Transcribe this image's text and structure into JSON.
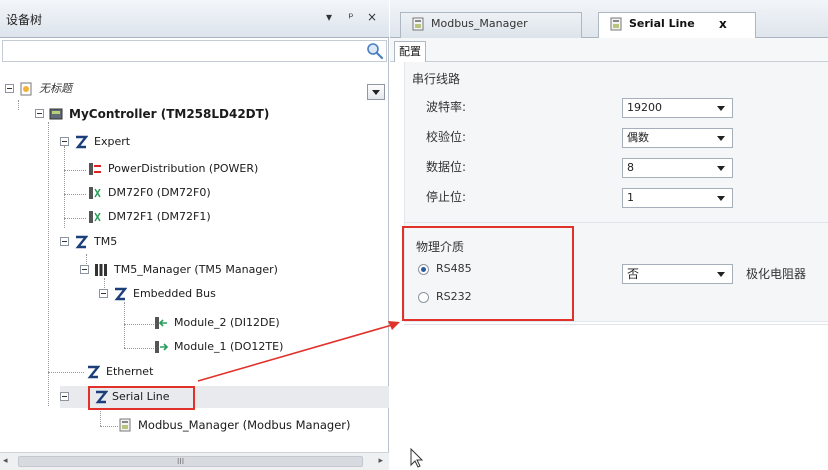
{
  "tree_panel": {
    "title": "设备树",
    "buttons": {
      "dropdown": "▾",
      "pin": "ᵖ",
      "close": "×"
    }
  },
  "tree": {
    "root": "无标题",
    "controller": "MyController (TM258LD42DT)",
    "expert": "Expert",
    "power_distribution": "PowerDistribution (POWER)",
    "dm72f0": "DM72F0 (DM72F0)",
    "dm72f1": "DM72F1 (DM72F1)",
    "tm5": "TM5",
    "tm5_manager": "TM5_Manager (TM5 Manager)",
    "embedded_bus": "Embedded Bus",
    "module_2": "Module_2 (DI12DE)",
    "module_1": "Module_1 (DO12TE)",
    "ethernet": "Ethernet",
    "serial_line": "Serial Line",
    "modbus_manager": "Modbus_Manager (Modbus Manager)"
  },
  "scrollbar": {
    "left": "◂",
    "right": "▸",
    "grip": "III"
  },
  "editor": {
    "tabs": [
      {
        "label": "Modbus_Manager"
      },
      {
        "label": "Serial Line",
        "close": "x"
      }
    ],
    "subtab": "配置",
    "serial_section": "串行线路",
    "fields": {
      "baud_label": "波特率:",
      "baud_value": "19200",
      "parity_label": "校验位:",
      "parity_value": "偶数",
      "data_bits_label": "数据位:",
      "data_bits_value": "8",
      "stop_bits_label": "停止位:",
      "stop_bits_value": "1"
    },
    "physical_section": "物理介质",
    "rs485": "RS485",
    "rs232": "RS232",
    "polarization_value": "否",
    "polarization_label": "极化电阻器"
  },
  "colors": {
    "highlight": "#e0322b",
    "accent": "#2c5aa0"
  }
}
